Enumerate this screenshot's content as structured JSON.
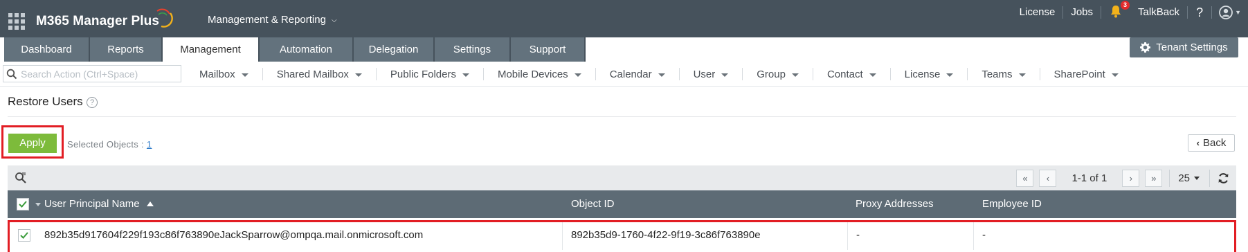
{
  "app": {
    "brand": "M365 Manager Plus",
    "module": "Management & Reporting"
  },
  "header_links": {
    "license": "License",
    "jobs": "Jobs",
    "notifications_count": "3",
    "talkback": "TalkBack",
    "help": "?"
  },
  "tabs": [
    {
      "label": "Dashboard",
      "active": false
    },
    {
      "label": "Reports",
      "active": false
    },
    {
      "label": "Management",
      "active": true
    },
    {
      "label": "Automation",
      "active": false
    },
    {
      "label": "Delegation",
      "active": false
    },
    {
      "label": "Settings",
      "active": false
    },
    {
      "label": "Support",
      "active": false
    }
  ],
  "tenant_settings": "Tenant Settings",
  "search": {
    "placeholder": "Search Action (Ctrl+Space)",
    "value": ""
  },
  "action_menu": [
    "Mailbox",
    "Shared Mailbox",
    "Public Folders",
    "Mobile Devices",
    "Calendar",
    "User",
    "Group",
    "Contact",
    "License",
    "Teams",
    "SharePoint"
  ],
  "page": {
    "title": "Restore Users",
    "help_icon": "?",
    "apply_label": "Apply",
    "selected_objects_label": "Selected Objects :",
    "selected_objects_count": "1",
    "back_label": "Back"
  },
  "pager": {
    "info": "1-1 of 1",
    "page_size": "25"
  },
  "table": {
    "columns": [
      "User Principal Name",
      "Object ID",
      "Proxy Addresses",
      "Employee ID"
    ],
    "sort_column": "User Principal Name",
    "sort_direction": "ascending",
    "rows": [
      {
        "checked": true,
        "upn": "892b35d917604f229f193c86f763890eJackSparrow@ompqa.mail.onmicrosoft.com",
        "object_id": "892b35d9-1760-4f22-9f19-3c86f763890e",
        "proxy_addresses": "-",
        "employee_id": "-"
      }
    ]
  },
  "colors": {
    "topbar": "#46525c",
    "tab_bg": "#63727d",
    "apply_green": "#7dbb3b",
    "highlight_red": "#e21d24",
    "table_header": "#5d6b75",
    "notification_red": "#e32b2b"
  }
}
